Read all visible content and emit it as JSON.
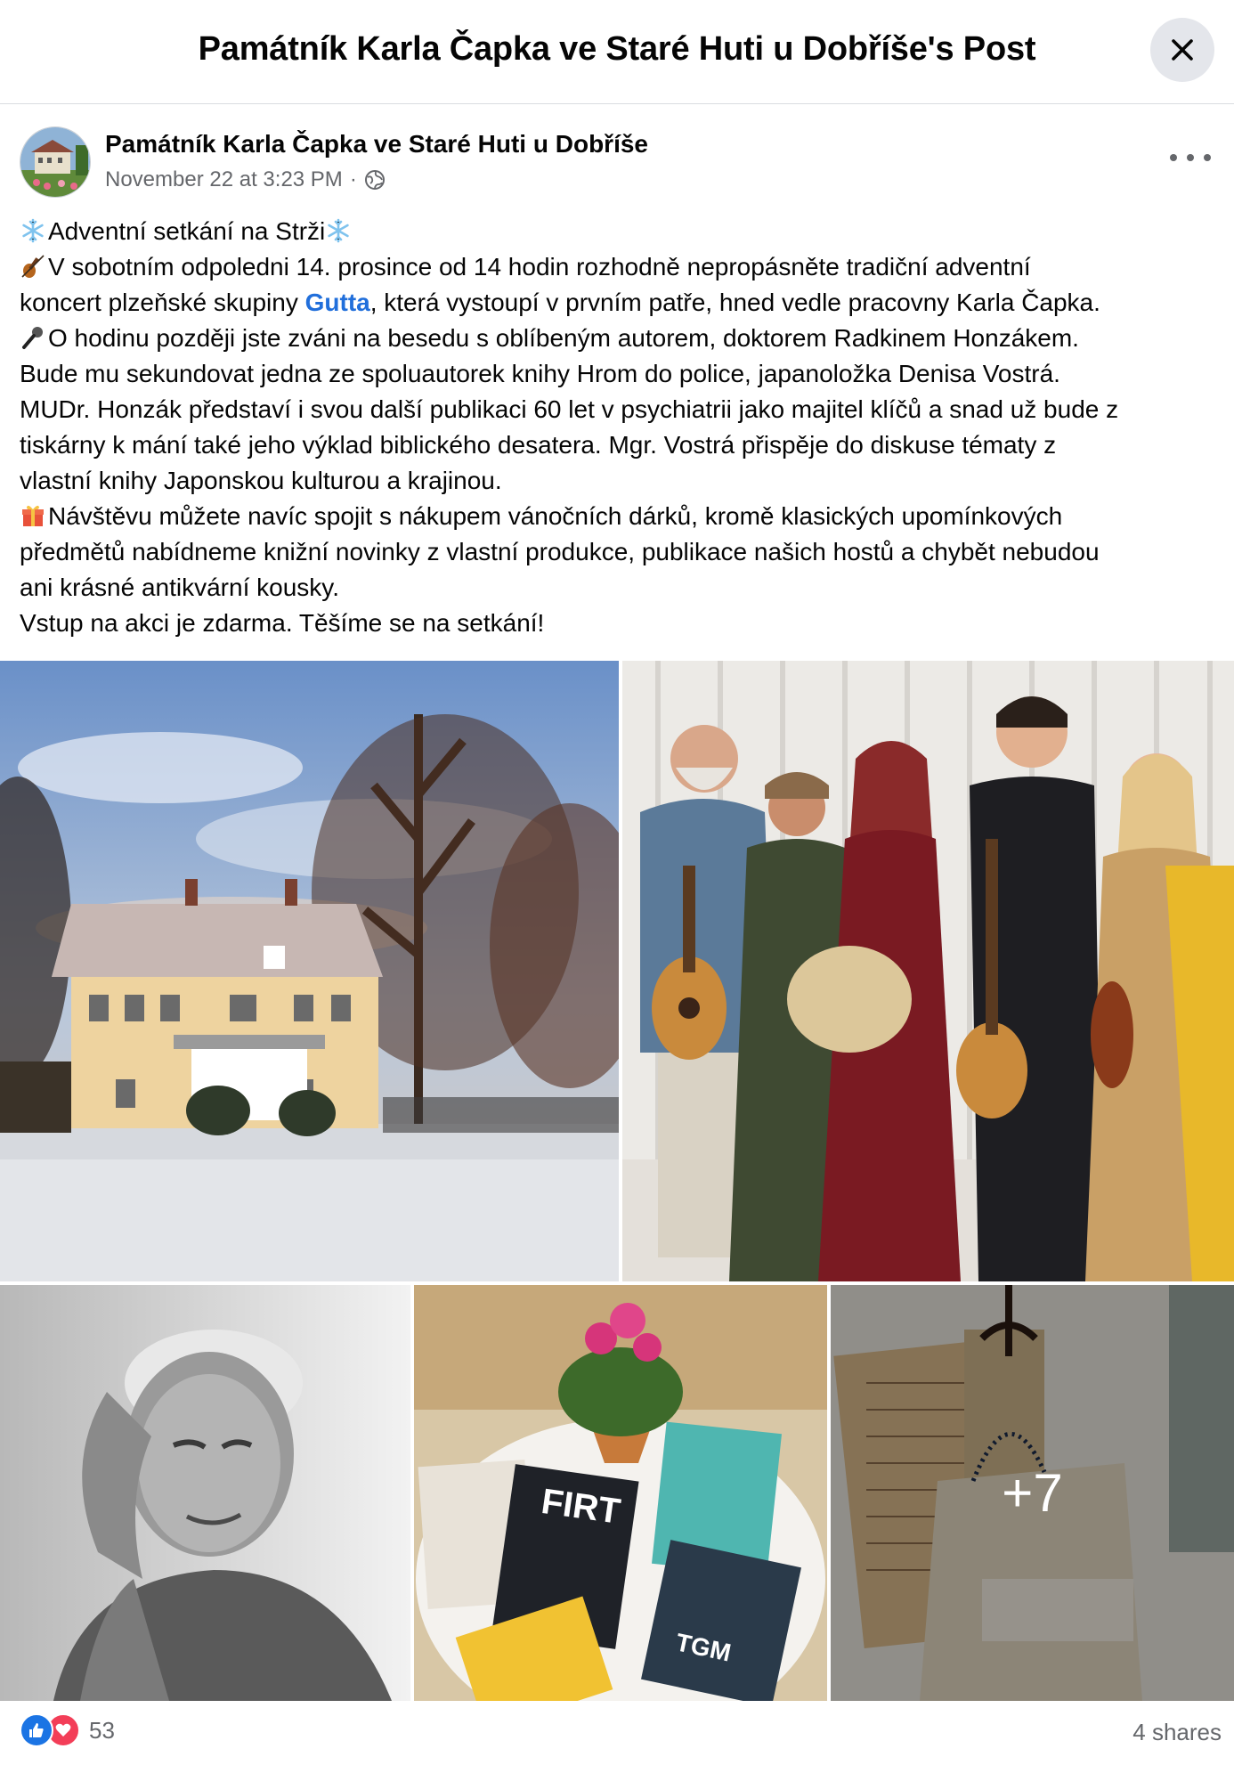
{
  "header": {
    "title": "Památník Karla Čapka ve Staré Huti u Dobříše's Post"
  },
  "post": {
    "author": "Památník Karla Čapka ve Staré Huti u Dobříše",
    "timestamp": "November 22 at 3:23 PM",
    "separator": "·",
    "audience_icon": "globe-icon",
    "lines": [
      {
        "icon": "snowflake",
        "text": "Adventní setkání na Strži",
        "icon_after": "snowflake"
      },
      {
        "icon": "violin",
        "text": "V sobotním odpoledni 14. prosince od 14 hodin rozhodně nepropásněte tradiční adventní"
      },
      {
        "pre": "koncert plzeňské skupiny ",
        "link": "Gutta",
        "post": ", která vystoupí v prvním patře, hned vedle pracovny Karla Čapka."
      },
      {
        "icon": "microphone",
        "text": "O hodinu později jste zváni na besedu s oblíbeným autorem, doktorem Radkinem Honzákem."
      },
      {
        "text": "Bude mu sekundovat jedna ze spoluautorek knihy Hrom do police, japanoložka Denisa Vostrá."
      },
      {
        "text": "MUDr. Honzák představí i svou další publikaci 60 let v psychiatrii jako majitel klíčů a snad už bude z"
      },
      {
        "text": "tiskárny k mání také jeho výklad biblického desatera. Mgr. Vostrá přispěje do diskuse tématy z"
      },
      {
        "text": "vlastní knihy Japonskou kulturou a krajinou."
      },
      {
        "icon": "gift",
        "text": "Návštěvu můžete navíc spojit s nákupem vánočních dárků, kromě klasických upomínkových"
      },
      {
        "text": "předmětů nabídneme knižní novinky z vlastní produkce, publikace našich hostů a chybět nebudou"
      },
      {
        "text": "ani krásné antikvární kousky."
      },
      {
        "text": "Vstup na akci je zdarma. Těšíme se na setkání!"
      }
    ]
  },
  "gallery": {
    "photos": [
      {
        "name": "villa-in-snow"
      },
      {
        "name": "band-gutta"
      },
      {
        "name": "author-portrait"
      },
      {
        "name": "books-on-table"
      },
      {
        "name": "antique-items"
      }
    ],
    "more_label": "+7"
  },
  "footer": {
    "reaction_icons": [
      "like-icon",
      "love-icon"
    ],
    "reaction_count": "53",
    "shares": "4 shares"
  },
  "colors": {
    "link": "#216fdb",
    "like": "#1b74e4",
    "love": "#f33e58",
    "meta": "#65676b"
  }
}
